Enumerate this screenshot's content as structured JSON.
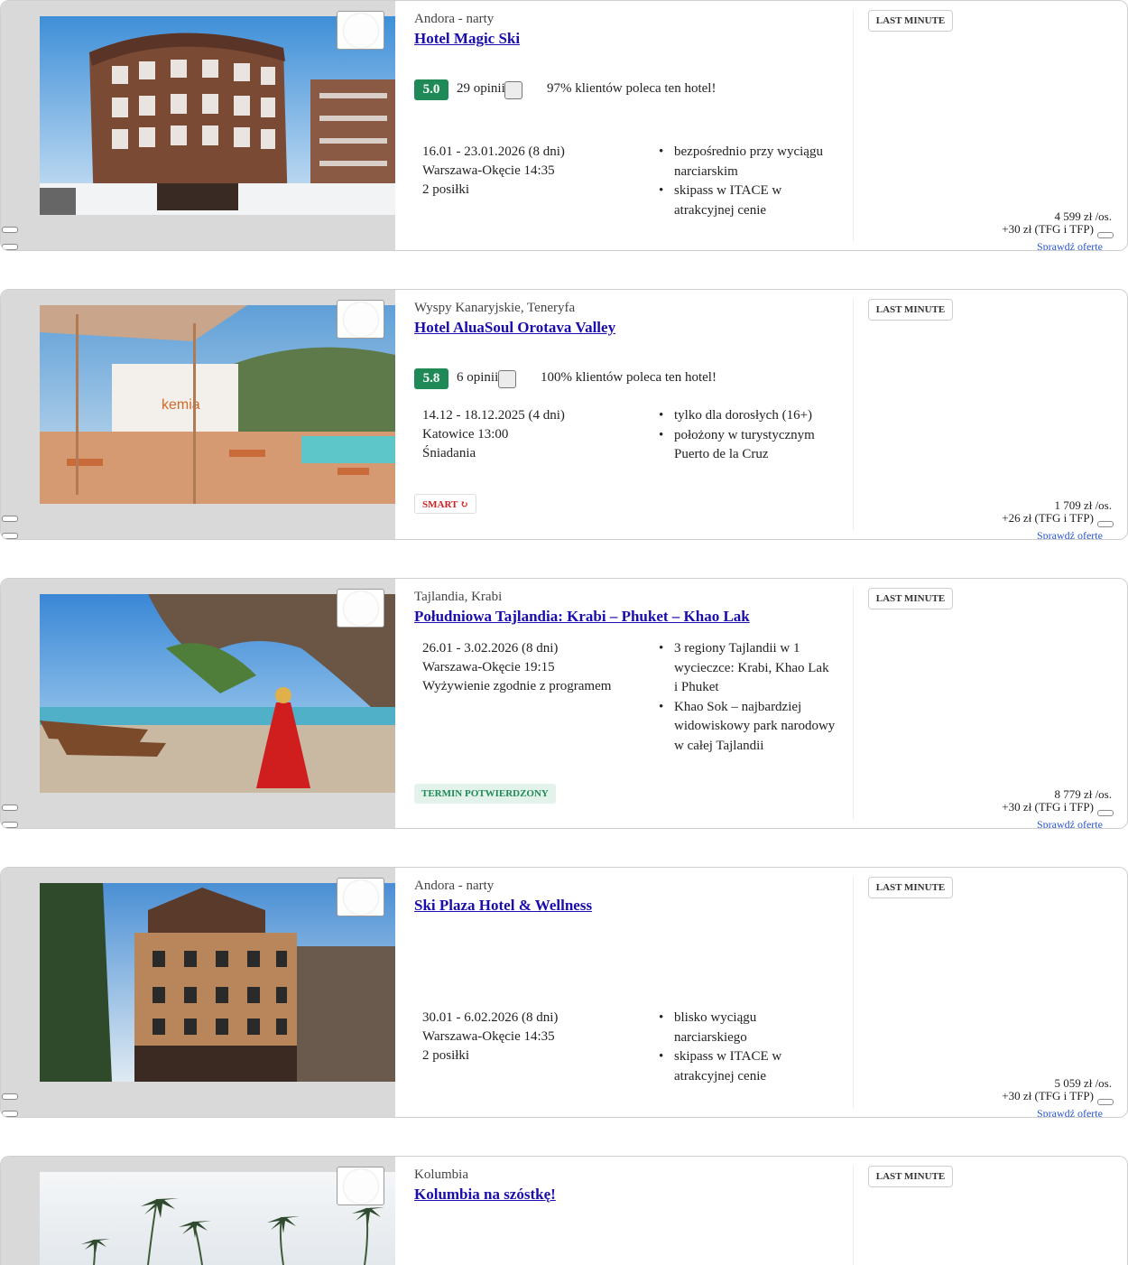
{
  "offers": [
    {
      "location": "Andora - narty",
      "name": "Hotel Magic Ski",
      "rating": {
        "score": "5.0",
        "reviews": "29 opinii",
        "recommend": "97% klientów poleca ten hotel!"
      },
      "dates": "16.01 - 23.01.2026 (8 dni)",
      "departure": "Warszawa-Okęcie 14:35",
      "board": "2 posiłki",
      "features": [
        [
          "bezpośrednio przy wyciągu",
          "narciarskim"
        ],
        [
          "skipass w ITACE w",
          "atrakcyjnej cenie"
        ]
      ],
      "badge": "LAST MINUTE",
      "price": "4 599 zł /os.",
      "fee": "+30 zł (TFG i TFP)",
      "more": "Sprawdź ofertę"
    },
    {
      "location": "Wyspy Kanaryjskie, Teneryfa",
      "name": "Hotel AluaSoul Orotava Valley",
      "rating": {
        "score": "5.8",
        "reviews": "6 opinii",
        "recommend": "100% klientów poleca ten hotel!"
      },
      "dates": "14.12 - 18.12.2025 (4 dni)",
      "departure": "Katowice 13:00",
      "board": "Śniadania",
      "features": [
        [
          "tylko dla dorosłych (16+)"
        ],
        [
          "położony w turystycznym",
          "Puerto de la Cruz"
        ]
      ],
      "tag": "SMART ↻",
      "badge": "LAST MINUTE",
      "price": "1 709 zł /os.",
      "fee": "+26 zł (TFG i TFP)",
      "more": "Sprawdź ofertę"
    },
    {
      "location": "Tajlandia, Krabi",
      "name": "Południowa Tajlandia: Krabi – Phuket – Khao Lak",
      "dates": "26.01 - 3.02.2026 (8 dni)",
      "departure": "Warszawa-Okęcie 19:15",
      "board": "Wyżywienie zgodnie z programem",
      "features": [
        [
          "3 regiony Tajlandii w 1",
          "wycieczce: Krabi, Khao Lak",
          "i Phuket"
        ],
        [
          "Khao Sok – najbardziej",
          "widowiskowy park narodowy",
          "w całej Tajlandii"
        ]
      ],
      "tag": "TERMIN POTWIERDZONY",
      "badge": "LAST MINUTE",
      "price": "8 779 zł /os.",
      "fee": "+30 zł (TFG i TFP)",
      "more": "Sprawdź ofertę"
    },
    {
      "location": "Andora - narty",
      "name": "Ski Plaza Hotel & Wellness",
      "dates": "30.01 - 6.02.2026 (8 dni)",
      "departure": "Warszawa-Okęcie 14:35",
      "board": "2 posiłki",
      "features": [
        [
          "blisko wyciągu",
          "narciarskiego"
        ],
        [
          "skipass w ITACE w",
          "atrakcyjnej cenie"
        ]
      ],
      "badge": "LAST MINUTE",
      "price": "5 059 zł /os.",
      "fee": "+30 zł (TFG i TFP)",
      "more": "Sprawdź ofertę"
    },
    {
      "location": "Kolumbia",
      "name": "Kolumbia na szóstkę!",
      "badge": "LAST MINUTE"
    }
  ]
}
